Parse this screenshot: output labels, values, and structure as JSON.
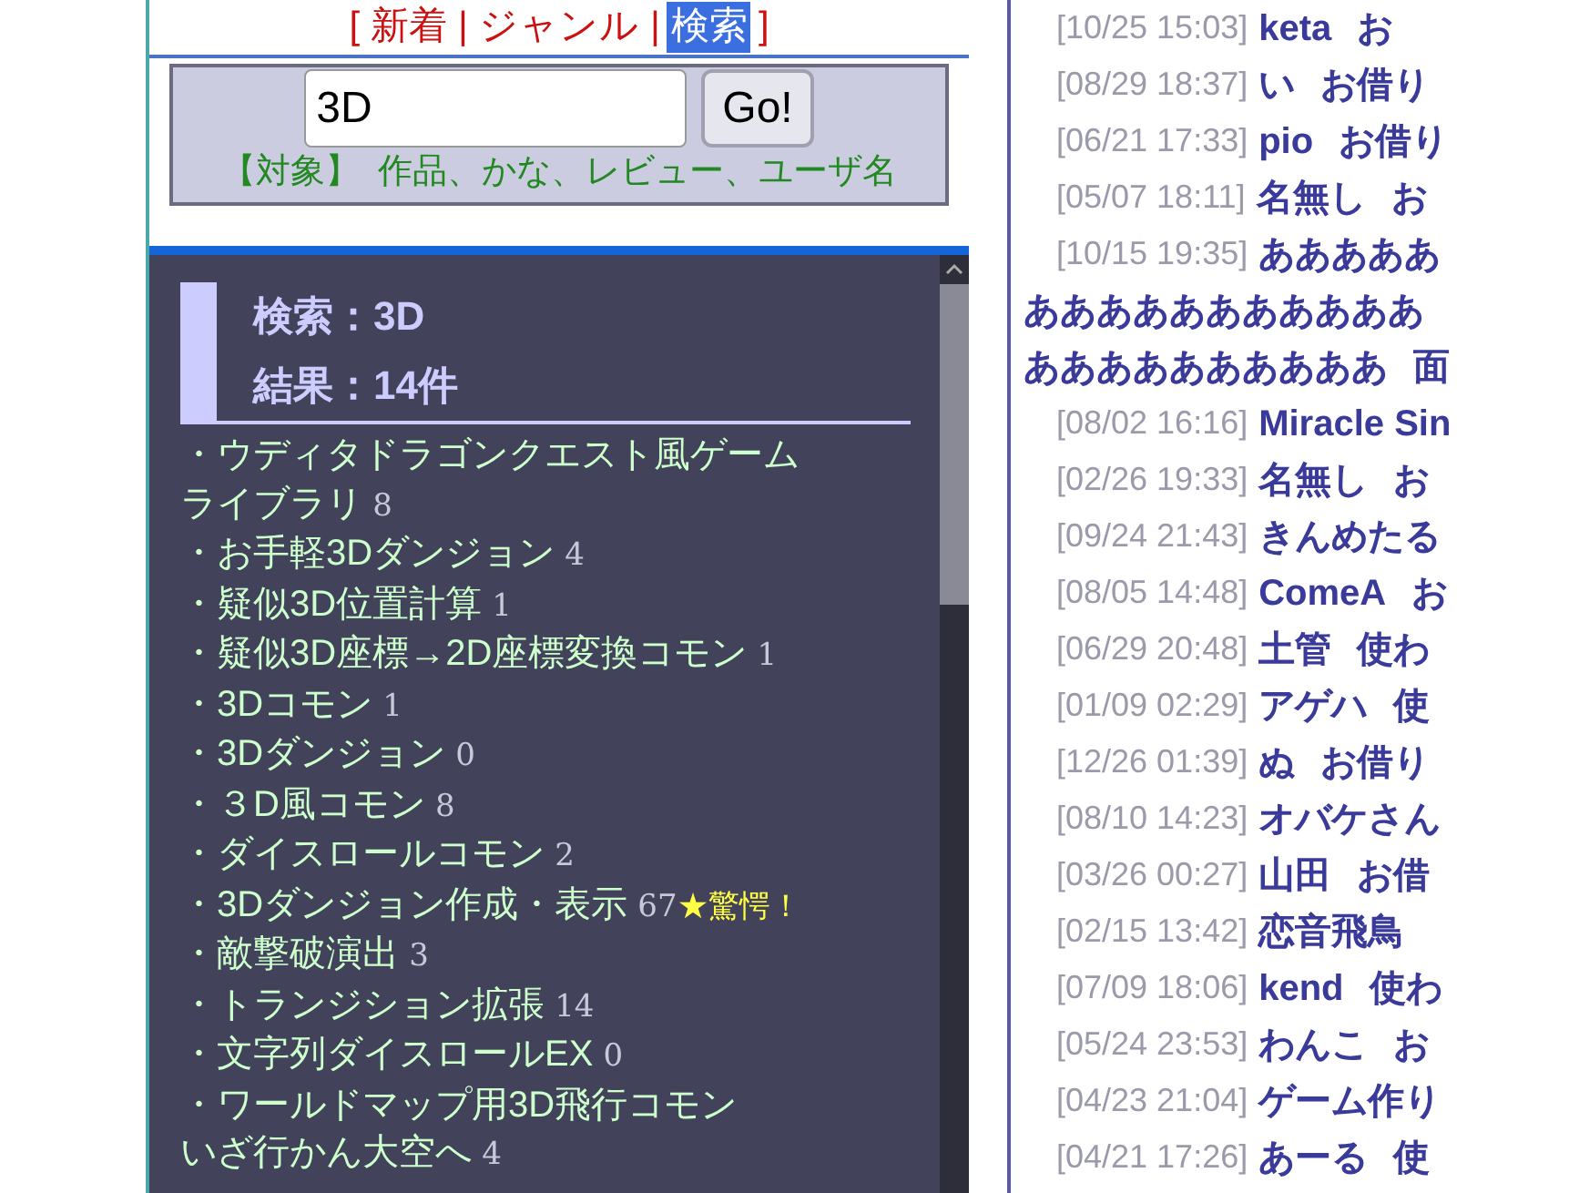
{
  "nav": [
    {
      "kind": "bracket",
      "text": "["
    },
    {
      "kind": "tab",
      "label": "新着",
      "selected": false
    },
    {
      "kind": "separator",
      "text": "|"
    },
    {
      "kind": "tab",
      "label": "ジャンル",
      "selected": false
    },
    {
      "kind": "separator",
      "text": "|"
    },
    {
      "kind": "tab",
      "label": "検索",
      "selected": true
    },
    {
      "kind": "bracket",
      "text": "]"
    }
  ],
  "search": {
    "value": "3D",
    "button": "Go!",
    "target_label": "【対象】",
    "target_text": "作品、かな、レビュー、ユーザ名"
  },
  "results": {
    "query": "検索：3D",
    "count": "結果：14件",
    "items": [
      {
        "title_lines": [
          "・ウディタドラゴンクエスト風ゲーム",
          "ライブラリ"
        ],
        "count": "8"
      },
      {
        "title": "・お手軽3Dダンジョン",
        "count": "4"
      },
      {
        "title": "・疑似3D位置計算",
        "count": "1"
      },
      {
        "title": "・疑似3D座標→2D座標変換コモン",
        "count": "1"
      },
      {
        "title": "・3Dコモン",
        "count": "1"
      },
      {
        "title": "・3Dダンジョン",
        "count": "0"
      },
      {
        "title": "・３D風コモン",
        "count": "8"
      },
      {
        "title": "・ダイスロールコモン",
        "count": "2"
      },
      {
        "title": "・3Dダンジョン作成・表示",
        "count": "67",
        "badge": "★驚愕！"
      },
      {
        "title": "・敵撃破演出",
        "count": "3"
      },
      {
        "title": "・トランジション拡張",
        "count": "14"
      },
      {
        "title": "・文字列ダイスロールEX",
        "count": "0"
      },
      {
        "title_lines": [
          "・ワールドマップ用3D飛行コモン",
          "いざ行かん大空へ"
        ],
        "count": "4"
      }
    ]
  },
  "reviews": [
    {
      "date": "[10/25 15:03]",
      "name": "keta",
      "comment": "お"
    },
    {
      "date": "[08/29 18:37]",
      "name": "い",
      "comment": "お借り"
    },
    {
      "date": "[06/21 17:33]",
      "name": "pio",
      "comment": "お借り"
    },
    {
      "date": "[05/07 18:11]",
      "name": "名無し",
      "comment": "お"
    },
    {
      "date": "[10/15 19:35]",
      "name_lines": [
        "あああああ",
        "あああああああああああ",
        "ああああああああああ"
      ],
      "comment": "面"
    },
    {
      "date": "[08/02 16:16]",
      "name": "Miracle Sin"
    },
    {
      "date": "[02/26 19:33]",
      "name": "名無し",
      "comment": "お"
    },
    {
      "date": "[09/24 21:43]",
      "name": "きんめたる"
    },
    {
      "date": "[08/05 14:48]",
      "name": "ComeA",
      "comment": "お"
    },
    {
      "date": "[06/29 20:48]",
      "name": "土管",
      "comment": "使わ"
    },
    {
      "date": "[01/09 02:29]",
      "name": "アゲハ",
      "comment": "使"
    },
    {
      "date": "[12/26 01:39]",
      "name": "ぬ",
      "comment": "お借り"
    },
    {
      "date": "[08/10 14:23]",
      "name": "オバケさん"
    },
    {
      "date": "[03/26 00:27]",
      "name": "山田",
      "comment": "お借"
    },
    {
      "date": "[02/15 13:42]",
      "name": "恋音飛鳥"
    },
    {
      "date": "[07/09 18:06]",
      "name": "kend",
      "comment": "使わ"
    },
    {
      "date": "[05/24 23:53]",
      "name": "わんこ",
      "comment": "お"
    },
    {
      "date": "[04/23 21:04]",
      "name": "ゲーム作り"
    },
    {
      "date": "[04/21 17:26]",
      "name": "あーる",
      "comment": "使"
    }
  ]
}
